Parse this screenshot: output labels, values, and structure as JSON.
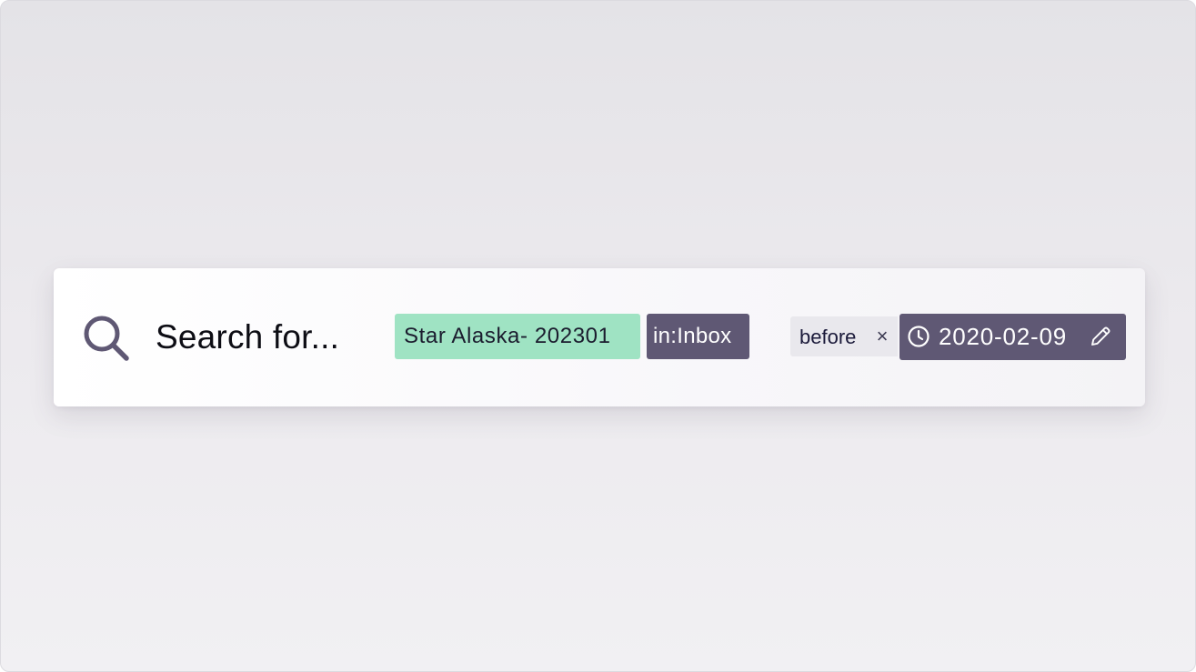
{
  "search": {
    "placeholder": "Search for...",
    "icon": "search-icon"
  },
  "tokens": {
    "query": {
      "label": "Star Alaska- 202301",
      "color": "#9fe3c3"
    },
    "folder": {
      "label": "in:Inbox",
      "color": "#5f5874"
    },
    "date_filter": {
      "key": "before",
      "remove_label": "×",
      "value": "2020-02-09",
      "value_icon": "clock-icon",
      "edit_icon": "pencil-icon",
      "color": "#5f5874"
    }
  },
  "colors": {
    "background": "#e8e7eb",
    "panel": "#ffffff",
    "accent_green": "#9fe3c3",
    "accent_purple": "#5f5874"
  }
}
